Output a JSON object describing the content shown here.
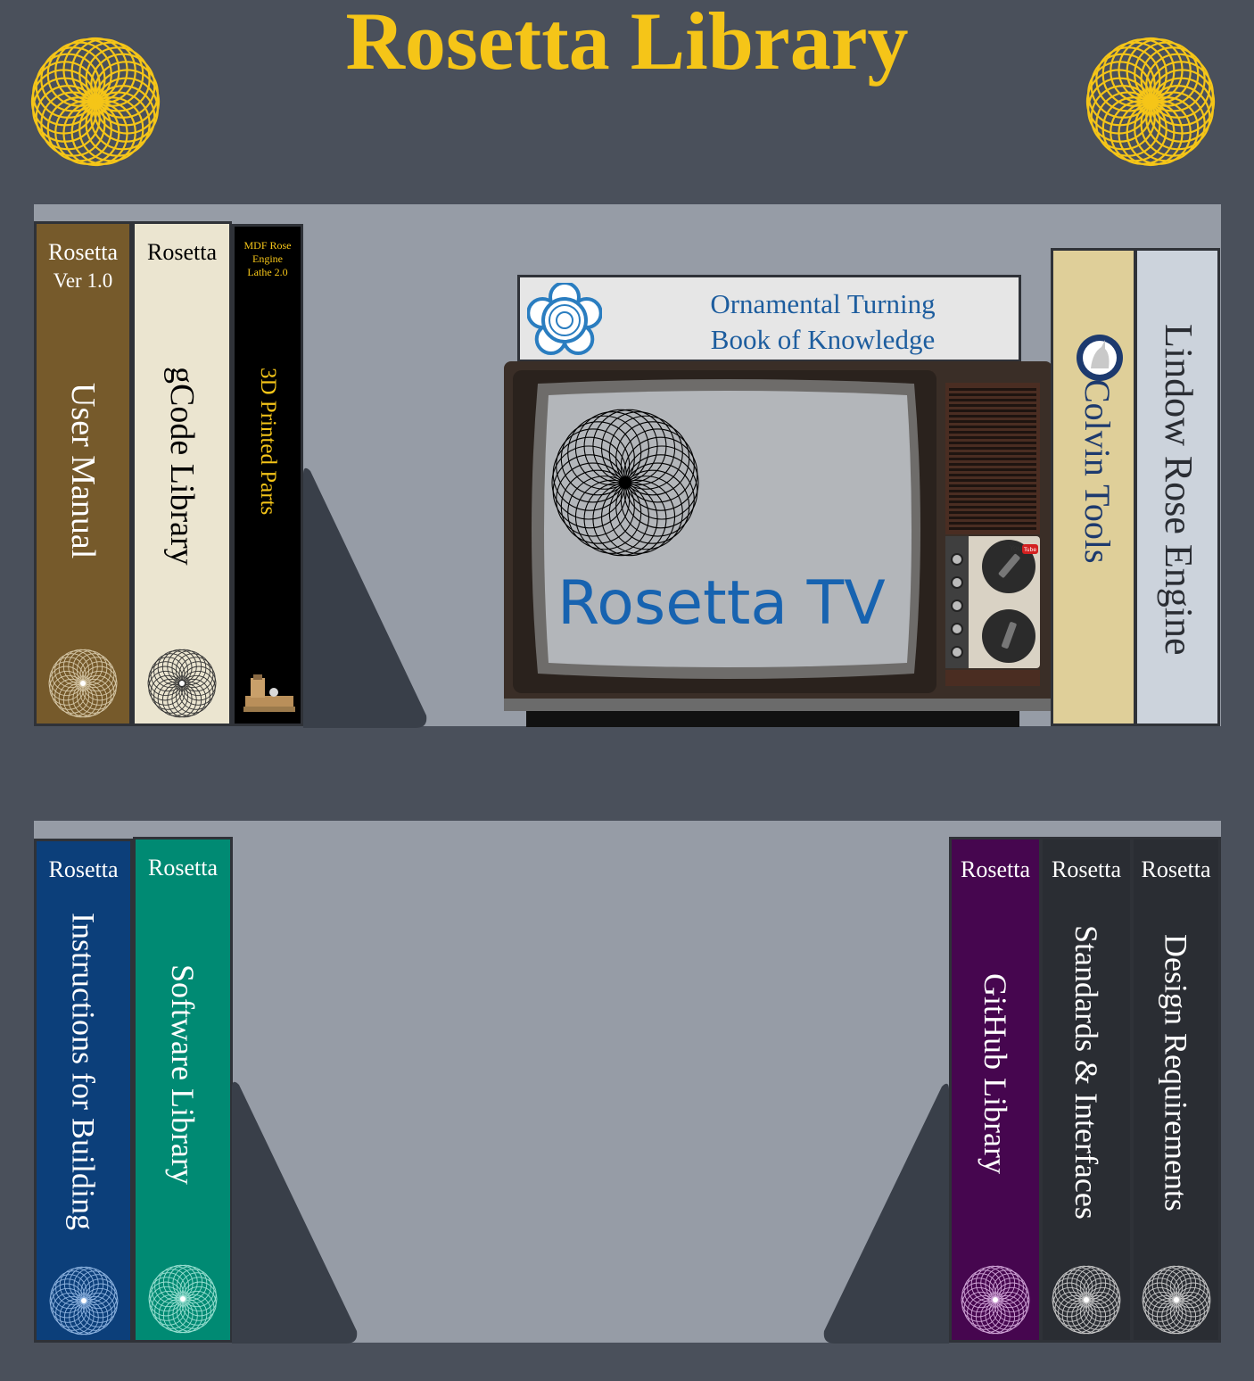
{
  "header": {
    "title": "Rosetta Library",
    "accent_color": "#f5c518",
    "left_icon": "rosette-icon",
    "right_icon": "rosette-icon"
  },
  "shelf_top": {
    "books": [
      {
        "top_line1": "Rosetta",
        "top_line2": "Ver 1.0",
        "spine": "User Manual",
        "color": "#765a2b",
        "text_color": "#ffffff",
        "icon": "rosette-icon"
      },
      {
        "top_line1": "Rosetta",
        "spine": "gCode Library",
        "color": "#ebe5d0",
        "text_color": "#000000",
        "icon": "rosette-icon"
      },
      {
        "top_line1": "MDF Rose",
        "top_line2": "Engine",
        "top_line3": "Lathe 2.0",
        "spine": "3D Printed Parts",
        "color": "#000000",
        "text_color": "#f5c518",
        "icon": "lathe-icon"
      }
    ],
    "okb": {
      "line1": "Ornamental Turning",
      "line2": "Book of Knowledge",
      "icon": "tudor-rose-icon"
    },
    "tv": {
      "label": "Rosetta TV",
      "icon": "youtube-icon"
    },
    "right_books": [
      {
        "spine": "Colvin Tools",
        "icon": "unicorn-logo-icon",
        "color": "#dfcf99"
      },
      {
        "spine": "Lindow Rose Engine",
        "color": "#ccd3dc"
      }
    ]
  },
  "shelf_bottom": {
    "left_books": [
      {
        "top_line1": "Rosetta",
        "spine": "Instructions for Building",
        "color": "#0c3f7a"
      },
      {
        "top_line1": "Rosetta",
        "spine": "Software Library",
        "color": "#008a73"
      }
    ],
    "right_books": [
      {
        "top_line1": "Rosetta",
        "spine": "GitHub Library",
        "color": "#46064f"
      },
      {
        "top_line1": "Rosetta",
        "spine": "Standards & Interfaces",
        "color": "#2a2d33"
      },
      {
        "top_line1": "Rosetta",
        "spine": "Design Requirements",
        "color": "#2a2d33"
      }
    ]
  }
}
